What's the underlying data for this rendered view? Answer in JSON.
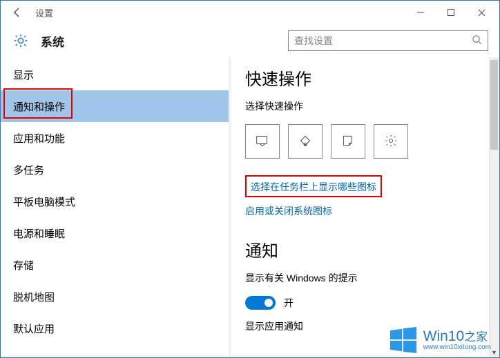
{
  "window": {
    "app_title": "设置",
    "buttons": {
      "minimize": "—",
      "maximize": "☐",
      "close": "✕"
    }
  },
  "header": {
    "section": "系统",
    "search_placeholder": "查找设置"
  },
  "sidebar": {
    "items": [
      {
        "label": "显示"
      },
      {
        "label": "通知和操作"
      },
      {
        "label": "应用和功能"
      },
      {
        "label": "多任务"
      },
      {
        "label": "平板电脑模式"
      },
      {
        "label": "电源和睡眠"
      },
      {
        "label": "存储"
      },
      {
        "label": "脱机地图"
      },
      {
        "label": "默认应用"
      }
    ],
    "selected_index": 1
  },
  "content": {
    "quick_actions": {
      "heading": "快速操作",
      "subheading": "选择快速操作",
      "tiles": [
        {
          "name": "tablet-mode",
          "icon": "tablet"
        },
        {
          "name": "rotation-lock",
          "icon": "rotation"
        },
        {
          "name": "note",
          "icon": "note"
        },
        {
          "name": "all-settings",
          "icon": "gear"
        }
      ],
      "link1": "选择在任务栏上显示哪些图标",
      "link2": "启用或关闭系统图标"
    },
    "notifications": {
      "heading": "通知",
      "row1_label": "显示有关 Windows 的提示",
      "row1_state": "开",
      "row2_label": "显示应用通知"
    }
  },
  "watermark": {
    "brand": "Win10",
    "suffix": "之家",
    "url": "www.win10xitong.com"
  }
}
